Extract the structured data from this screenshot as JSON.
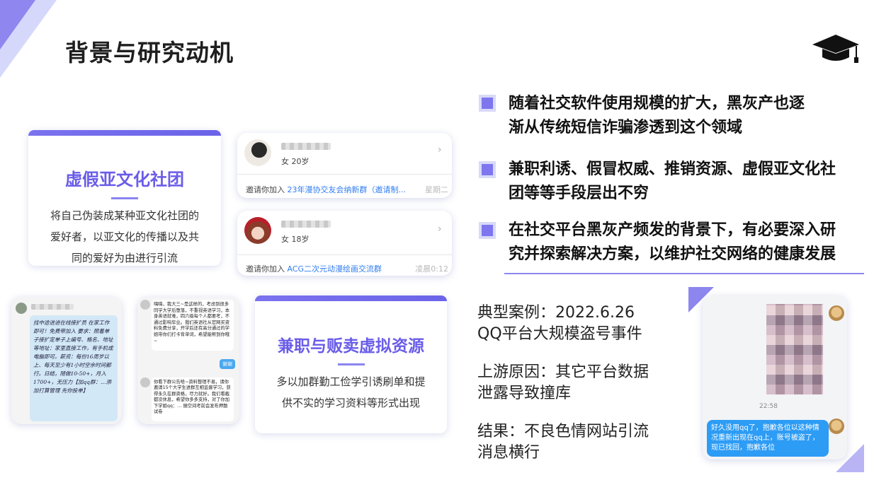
{
  "page": {
    "title": "背景与研究动机"
  },
  "cards": [
    {
      "heading": "虚假亚文化社团",
      "body": [
        "将自己伪装成某种亚文化社团的",
        "爱好者，以亚文化的传播以及共",
        "同的爱好为由进行引流"
      ]
    },
    {
      "heading": "兼职与贩卖虚拟资源",
      "body": [
        "多以加群勤工俭学引诱刷单和提",
        "供不实的学习资料等形式出现"
      ]
    }
  ],
  "chats": [
    {
      "profile": "女  20岁",
      "invite_prefix": "邀请你加入",
      "group": "23年漫协交友会纳新群（邀请制...",
      "time": "星期二"
    },
    {
      "profile": "女  18岁",
      "invite_prefix": "邀请你加入",
      "group": "ACG二次元动漫绘画交流群",
      "time": "凌晨0:12"
    }
  ],
  "screens": {
    "note_text": "找中途进进在线接扩员 在家工作即可！免费带加入 要求：照着单子接扩定单子上编号、格名、地址等地址：家里直接工作，有手机或电脑即可。薪资：每份16周岁以上、每天至少有1小时空余时间都行。日结，随做10-50+，月入1700+，无压力【加qq群：…添加打算管理 先你投单】",
    "msg1": "嗨嗨，我大三~是这样的，考虑到很多同学大学后堕落，不重视英语学习，本身英语就难，四六级每个人都要考，不通过影响毕业。我们英语社从官网买资料免费分享，开学后还有高分通过的学姐带你们打卡背单词，希望能帮到你哦~",
    "reply": "谢谢",
    "msg2": "你看下群公告哈~资料整理不易，请你邀请15个大学生进群互相监督学习，获得永久在群资格，尽力就好。我们看截都没休息，希望你多多支持，对了你加下学姐qq：…    随空间考前会发布押题试卷"
  },
  "bullets": [
    [
      "随着社交软件使用规模的扩大，黑灰产也逐",
      "渐从传统短信诈骗渗透到这个领域"
    ],
    [
      "兼职利诱、假冒权威、推销资源、虚假亚文化社",
      "团等等手段层出不穷"
    ],
    [
      "在社交平台黑灰产频发的背景下，有必要深入研",
      "究并探索解决方案，以维护社交网络的健康发展"
    ]
  ],
  "case": {
    "line1a": "典型案例：2022.6.26",
    "line1b": "QQ平台大规模盗号事件",
    "line2a": "上游原因：其它平台数据",
    "line2b": "泄露导致撞库",
    "line3a": "结果：不良色情网站引流",
    "line3b": "消息横行"
  },
  "qq": {
    "time": "22:58",
    "message": "好久没用qq了，抱歉各位以这种情况重新出现在qq上，账号被盗了，现已找回，抱歉各位"
  },
  "colors": {
    "accent": "#6a5ce8",
    "link": "#2f7df1",
    "bubble": "#2d9cf5"
  }
}
